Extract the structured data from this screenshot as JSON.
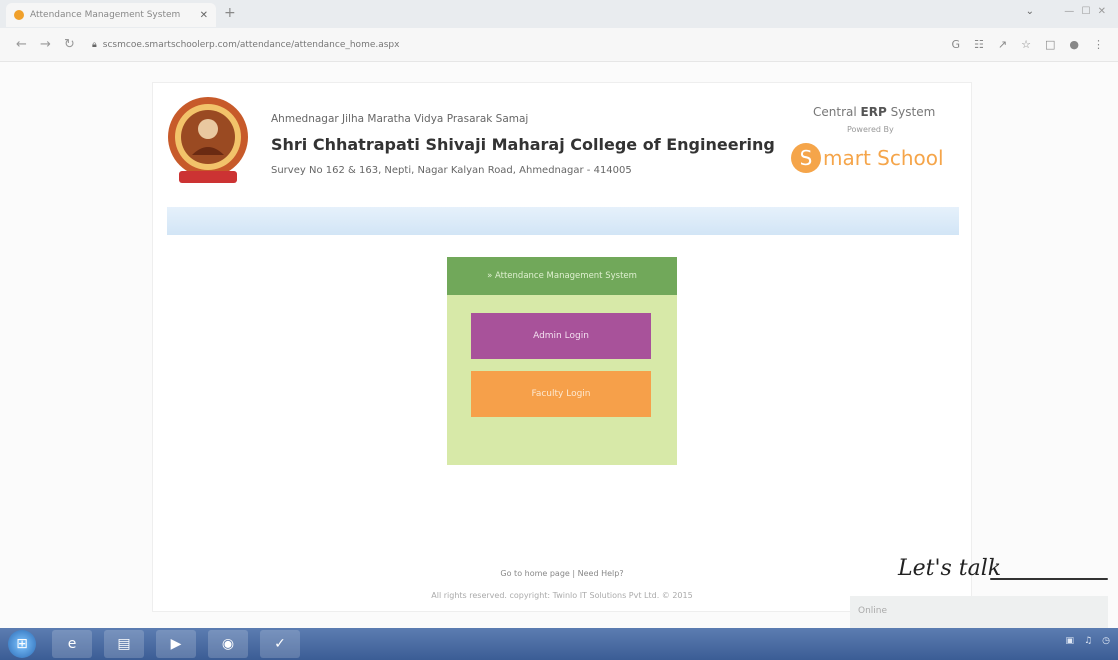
{
  "browser": {
    "tab_title": "Attendance Management System",
    "tab_close": "✕",
    "new_tab": "+",
    "url": "scsmcoe.smartschoolerp.com/attendance/attendance_home.aspx",
    "window_controls": "— ☐ ✕",
    "dropdown": "⌄",
    "back": "←",
    "forward": "→",
    "reload": "↻"
  },
  "header": {
    "society": "Ahmednagar Jilha Maratha Vidya Prasarak Samaj",
    "college": "Shri Chhatrapati Shivaji Maharaj College of Engineering",
    "address": "Survey No 162 & 163, Nepti, Nagar Kalyan Road, Ahmednagar - 414005",
    "erp_prefix": "Central ",
    "erp_bold": "ERP",
    "erp_suffix": " System",
    "powered_by": "Powered By",
    "brand_letter": "S",
    "brand_mid": "mart",
    "brand_end": "School"
  },
  "panel": {
    "title": "» Attendance Management System",
    "admin_login": "Admin Login",
    "faculty_login": "Faculty Login"
  },
  "footer": {
    "home_link": "Go to home page",
    "separator": " | ",
    "help_link": "Need Help?",
    "copyright": "All rights reserved. copyright: Twinlo IT Solutions Pvt Ltd. © 2015"
  },
  "chat": {
    "handwriting": "Let's talk",
    "status": "Online"
  },
  "colors": {
    "panel_head": "#71a85a",
    "panel_body": "#d7e9a8",
    "admin_button": "#a8529a",
    "faculty_button": "#f6a04a",
    "brand": "#f5a54a"
  }
}
